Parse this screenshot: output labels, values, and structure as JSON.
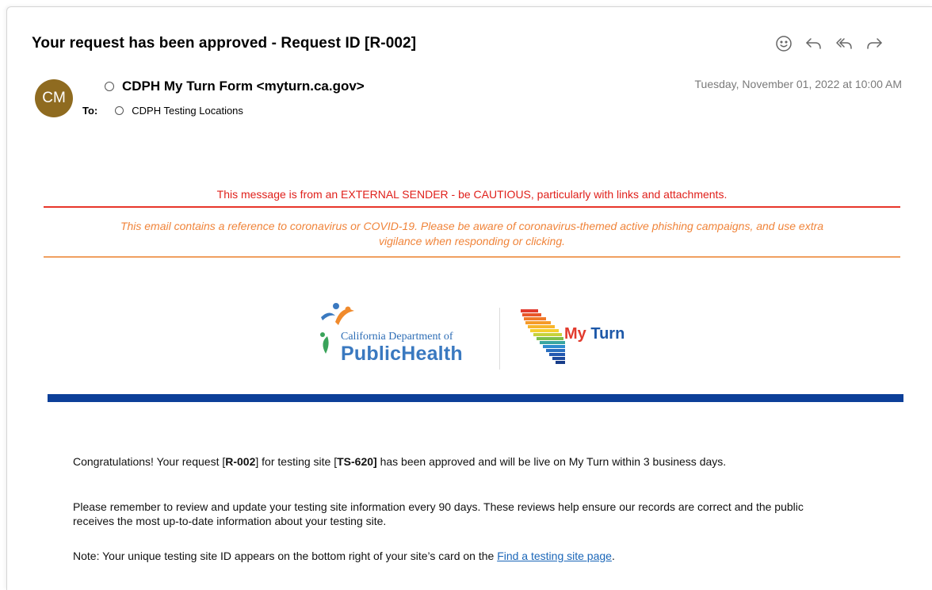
{
  "email": {
    "subject": "Your request has been approved - Request ID [R-002]",
    "avatar_initials": "CM",
    "sender": "CDPH My Turn Form <myturn.ca.gov>",
    "to_label": "To:",
    "to_recipient": "CDPH Testing Locations",
    "date": "Tuesday, November 01, 2022 at 10:00 AM"
  },
  "toolbar": {
    "icons": [
      "smiley-icon",
      "reply-icon",
      "reply-all-icon",
      "forward-icon"
    ]
  },
  "banners": {
    "external": "This message is from an EXTERNAL SENDER - be CAUTIOUS, particularly with links and attachments.",
    "covid_line1": "This email contains a reference to coronavirus or COVID-19. Please be aware of coronavirus-themed active phishing campaigns, and use extra",
    "covid_line2": "vigilance when responding or clicking."
  },
  "logos": {
    "cdph_small": "California Department of",
    "cdph_big": "PublicHealth",
    "myturn_my": "My",
    "myturn_turn": "Turn"
  },
  "body": {
    "p1_a": "Congratulations! Your request [",
    "p1_request_id": "R-002",
    "p1_b": "] for testing site [",
    "p1_site_id": "TS-620]",
    "p1_c": " has been approved and will be live on My Turn within 3 business days.",
    "p2": "Please remember to review and update your testing site information every 90 days. These reviews help ensure our records are correct and the public receives the most up-to-date information about your testing site.",
    "p3_a": "Note: Your unique testing site ID appears on the bottom right of your site’s card on the ",
    "p3_link": "Find a testing site page",
    "p3_b": "."
  },
  "colors": {
    "avatar": "#8f6b20",
    "external_warning": "#e0201b",
    "covid_warning": "#f0843a",
    "brand_bar": "#0c3f99",
    "link": "#1a66b8"
  }
}
